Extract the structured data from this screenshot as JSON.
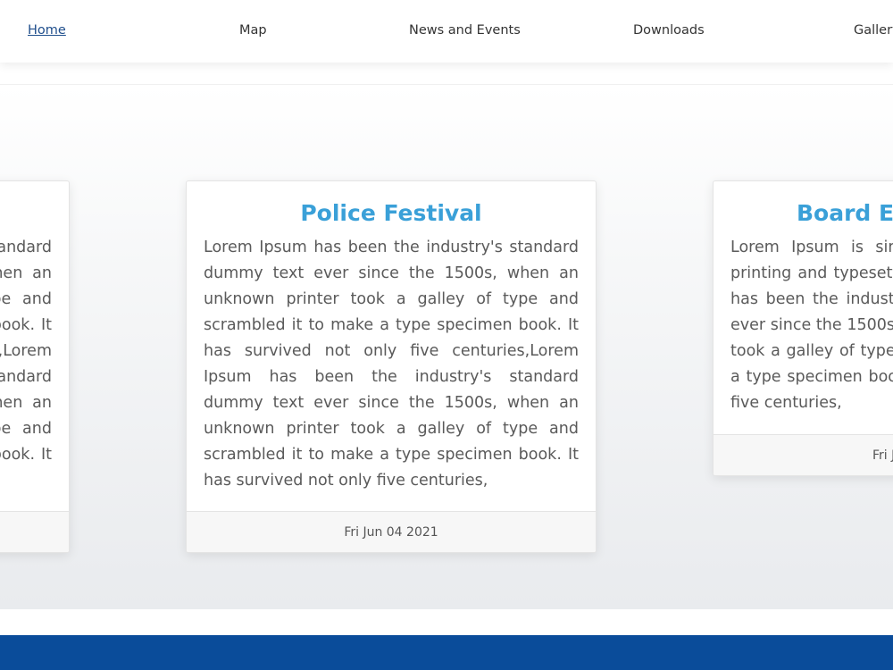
{
  "nav": {
    "items": [
      {
        "label": "Home",
        "active": true
      },
      {
        "label": "Map"
      },
      {
        "label": "News and Events"
      },
      {
        "label": "Downloads"
      },
      {
        "label": "Gallery"
      }
    ]
  },
  "cards": [
    {
      "title": "",
      "body": "Lorem Ipsum has been the industry's standard dummy text ever since the 1500s, when an unknown printer took a galley of type and scrambled it to make a type specimen book. It has survived not only five centuries,Lorem Ipsum has been the industry's standard dummy text ever since the 1500s, when an unknown printer took a galley of type and scrambled it to make a type specimen book. It has survived not only five centuries,",
      "date": ""
    },
    {
      "title": "Police Festival",
      "body": "Lorem Ipsum has been the industry's standard dummy text ever since the 1500s, when an unknown printer took a galley of type and scrambled it to make a type specimen book. It has survived not only five centuries,Lorem Ipsum has been the industry's standard dummy text ever since the 1500s, when an unknown printer took a galley of type and scrambled it to make a type specimen book. It has survived not only five centuries,",
      "date": "Fri Jun 04 2021"
    },
    {
      "title": "Board Exa",
      "body": "Lorem Ipsum is simply dummy text of the printing and typesetting industry. Lorem Ipsum has been the industry's standard dummy text ever since the 1500s, when an unknown printer took a galley of type and scrambled it to make a type specimen book. It has survived not only five centuries,",
      "date": "Fri J"
    }
  ],
  "colors": {
    "accent": "#3aa0d8",
    "footer": "#0a4c9a",
    "nav_active": "#1f4e8c"
  }
}
